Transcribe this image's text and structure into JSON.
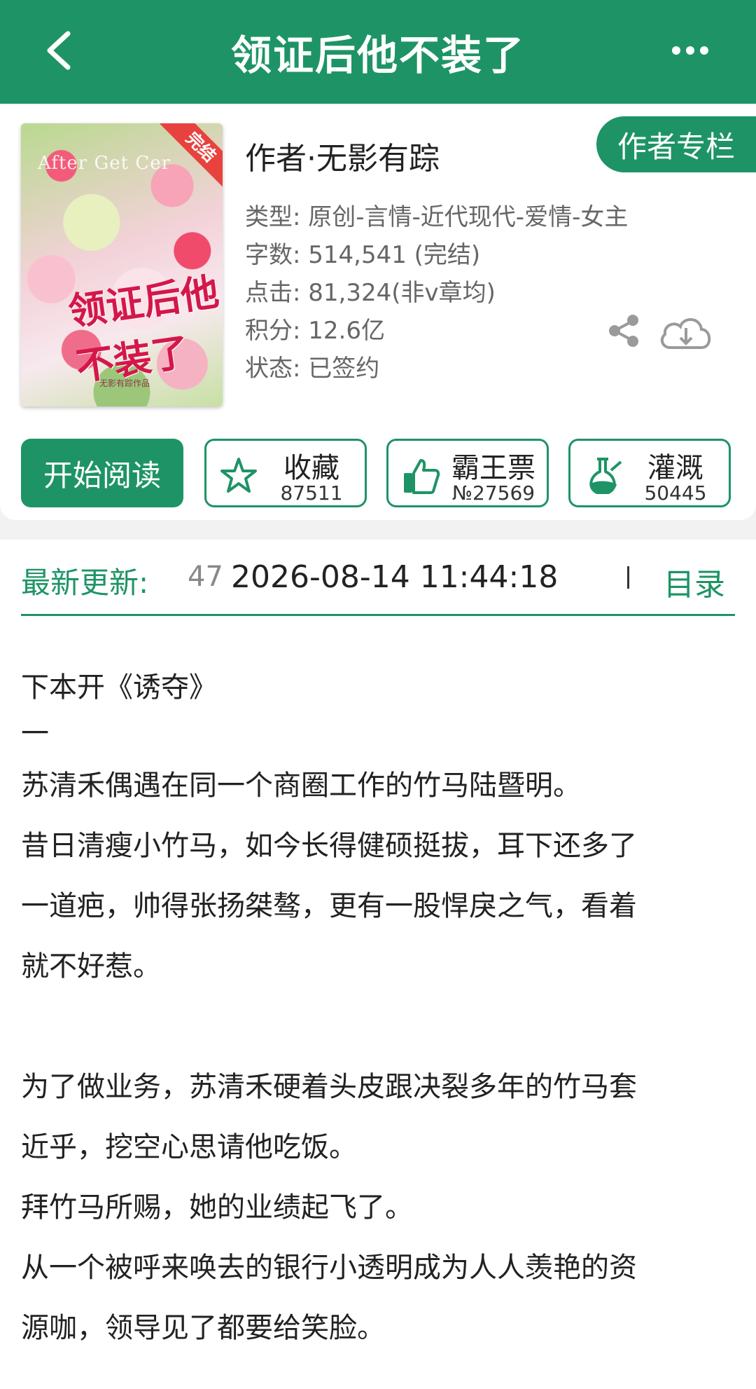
{
  "header": {
    "title": "领证后他不装了",
    "back_icon": "chevron-left-icon",
    "more_icon": "more-horizontal-icon"
  },
  "cover": {
    "en_title": "After Get Cer",
    "zh_title": "领证后他不装了",
    "small_text": "无影有踪作品",
    "ribbon": "完结"
  },
  "book": {
    "author": "作者·无影有踪",
    "author_column_label": "作者专栏",
    "type": "类型: 原创-言情-近代现代-爱情-女主",
    "word_count": "字数: 514,541 (完结)",
    "clicks": "点击: 81,324(非v章均)",
    "score": "积分: 12.6亿",
    "status": "状态: 已签约"
  },
  "actions": {
    "start_read": "开始阅读",
    "favorite": {
      "label": "收藏",
      "count": "87511",
      "icon": "star-icon"
    },
    "ticket": {
      "label": "霸王票",
      "count": "№27569",
      "icon": "thumbs-up-icon"
    },
    "nutrient": {
      "label": "灌溉",
      "count": "50445",
      "icon": "watering-flask-icon"
    }
  },
  "update": {
    "label": "最新更新:",
    "chapter": "47",
    "time": "2026-08-14 11:44:18",
    "toc": "目录"
  },
  "synopsis": {
    "lines": [
      "下本开《诱夺》",
      "一",
      "苏清禾偶遇在同一个商圈工作的竹马陆暨明。",
      "昔日清瘦小竹马，如今长得健硕挺拔，耳下还多了",
      "一道疤，帅得张扬桀骜，更有一股悍戾之气，看着",
      "就不好惹。",
      "为了做业务，苏清禾硬着头皮跟决裂多年的竹马套",
      "近乎，挖空心思请他吃饭。",
      "拜竹马所赐，她的业绩起飞了。",
      "从一个被呼来唤去的银行小透明成为人人羡艳的资",
      "源咖，领导见了都要给笑脸。"
    ]
  },
  "colors": {
    "brand_green": "#1e9466",
    "ribbon_red": "#e8423f"
  }
}
